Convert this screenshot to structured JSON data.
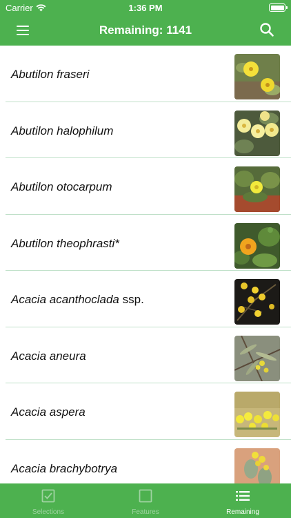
{
  "status_bar": {
    "carrier": "Carrier",
    "time": "1:36 PM"
  },
  "nav": {
    "title": "Remaining: 1141",
    "menu_icon": "hamburger-menu-icon",
    "search_icon": "search-icon"
  },
  "colors": {
    "brand_green": "#4db14f",
    "divider": "#bfe0c8",
    "tab_inactive": "#9fd3a1"
  },
  "species": [
    {
      "name": "Abutilon fraseri",
      "suffix": "",
      "photo": "yellow-flowers"
    },
    {
      "name": "Abutilon halophilum",
      "suffix": "",
      "photo": "pale-yellow-flowers"
    },
    {
      "name": "Abutilon otocarpum",
      "suffix": "",
      "photo": "yellow-flower-red-soil"
    },
    {
      "name": "Abutilon theophrasti*",
      "suffix": "",
      "photo": "orange-flower-leaves"
    },
    {
      "name": "Acacia acanthoclada",
      "suffix": " ssp.",
      "photo": "yellow-balls-dark"
    },
    {
      "name": "Acacia aneura",
      "suffix": "",
      "photo": "grey-green-leaves"
    },
    {
      "name": "Acacia aspera",
      "suffix": "",
      "photo": "yellow-puffballs"
    },
    {
      "name": "Acacia brachybotrya",
      "suffix": "",
      "photo": "yellow-balls-sand"
    }
  ],
  "tabs": [
    {
      "label": "Selections",
      "icon": "checkbox-checked-icon",
      "active": false
    },
    {
      "label": "Features",
      "icon": "checkbox-empty-icon",
      "active": false
    },
    {
      "label": "Remaining",
      "icon": "list-icon",
      "active": true
    }
  ]
}
